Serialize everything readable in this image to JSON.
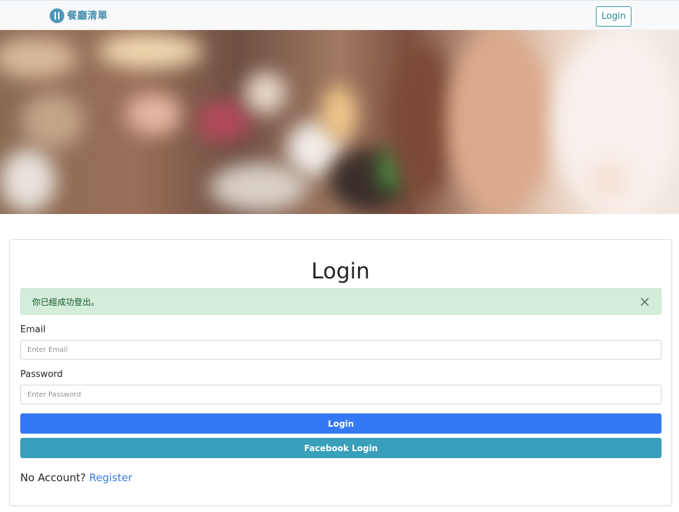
{
  "navbar": {
    "brand_text": "餐廳清單",
    "login_label": "Login"
  },
  "login_card": {
    "title": "Login",
    "alert_message": "你已經成功登出。",
    "alert_close": "×",
    "email_label": "Email",
    "email_placeholder": "Enter Email",
    "email_value": "",
    "password_label": "Password",
    "password_placeholder": "Enter Password",
    "password_value": "",
    "login_button": "Login",
    "facebook_button": "Facebook Login",
    "no_account_text": "No Account?",
    "register_link": "Register"
  },
  "colors": {
    "primary": "#3478f6",
    "info": "#3a9fba",
    "alert_bg": "#d4edda",
    "brand": "#4a90b0"
  },
  "icons": {
    "brand_logo": "fork-knife-icon",
    "alert_close": "close-icon"
  }
}
